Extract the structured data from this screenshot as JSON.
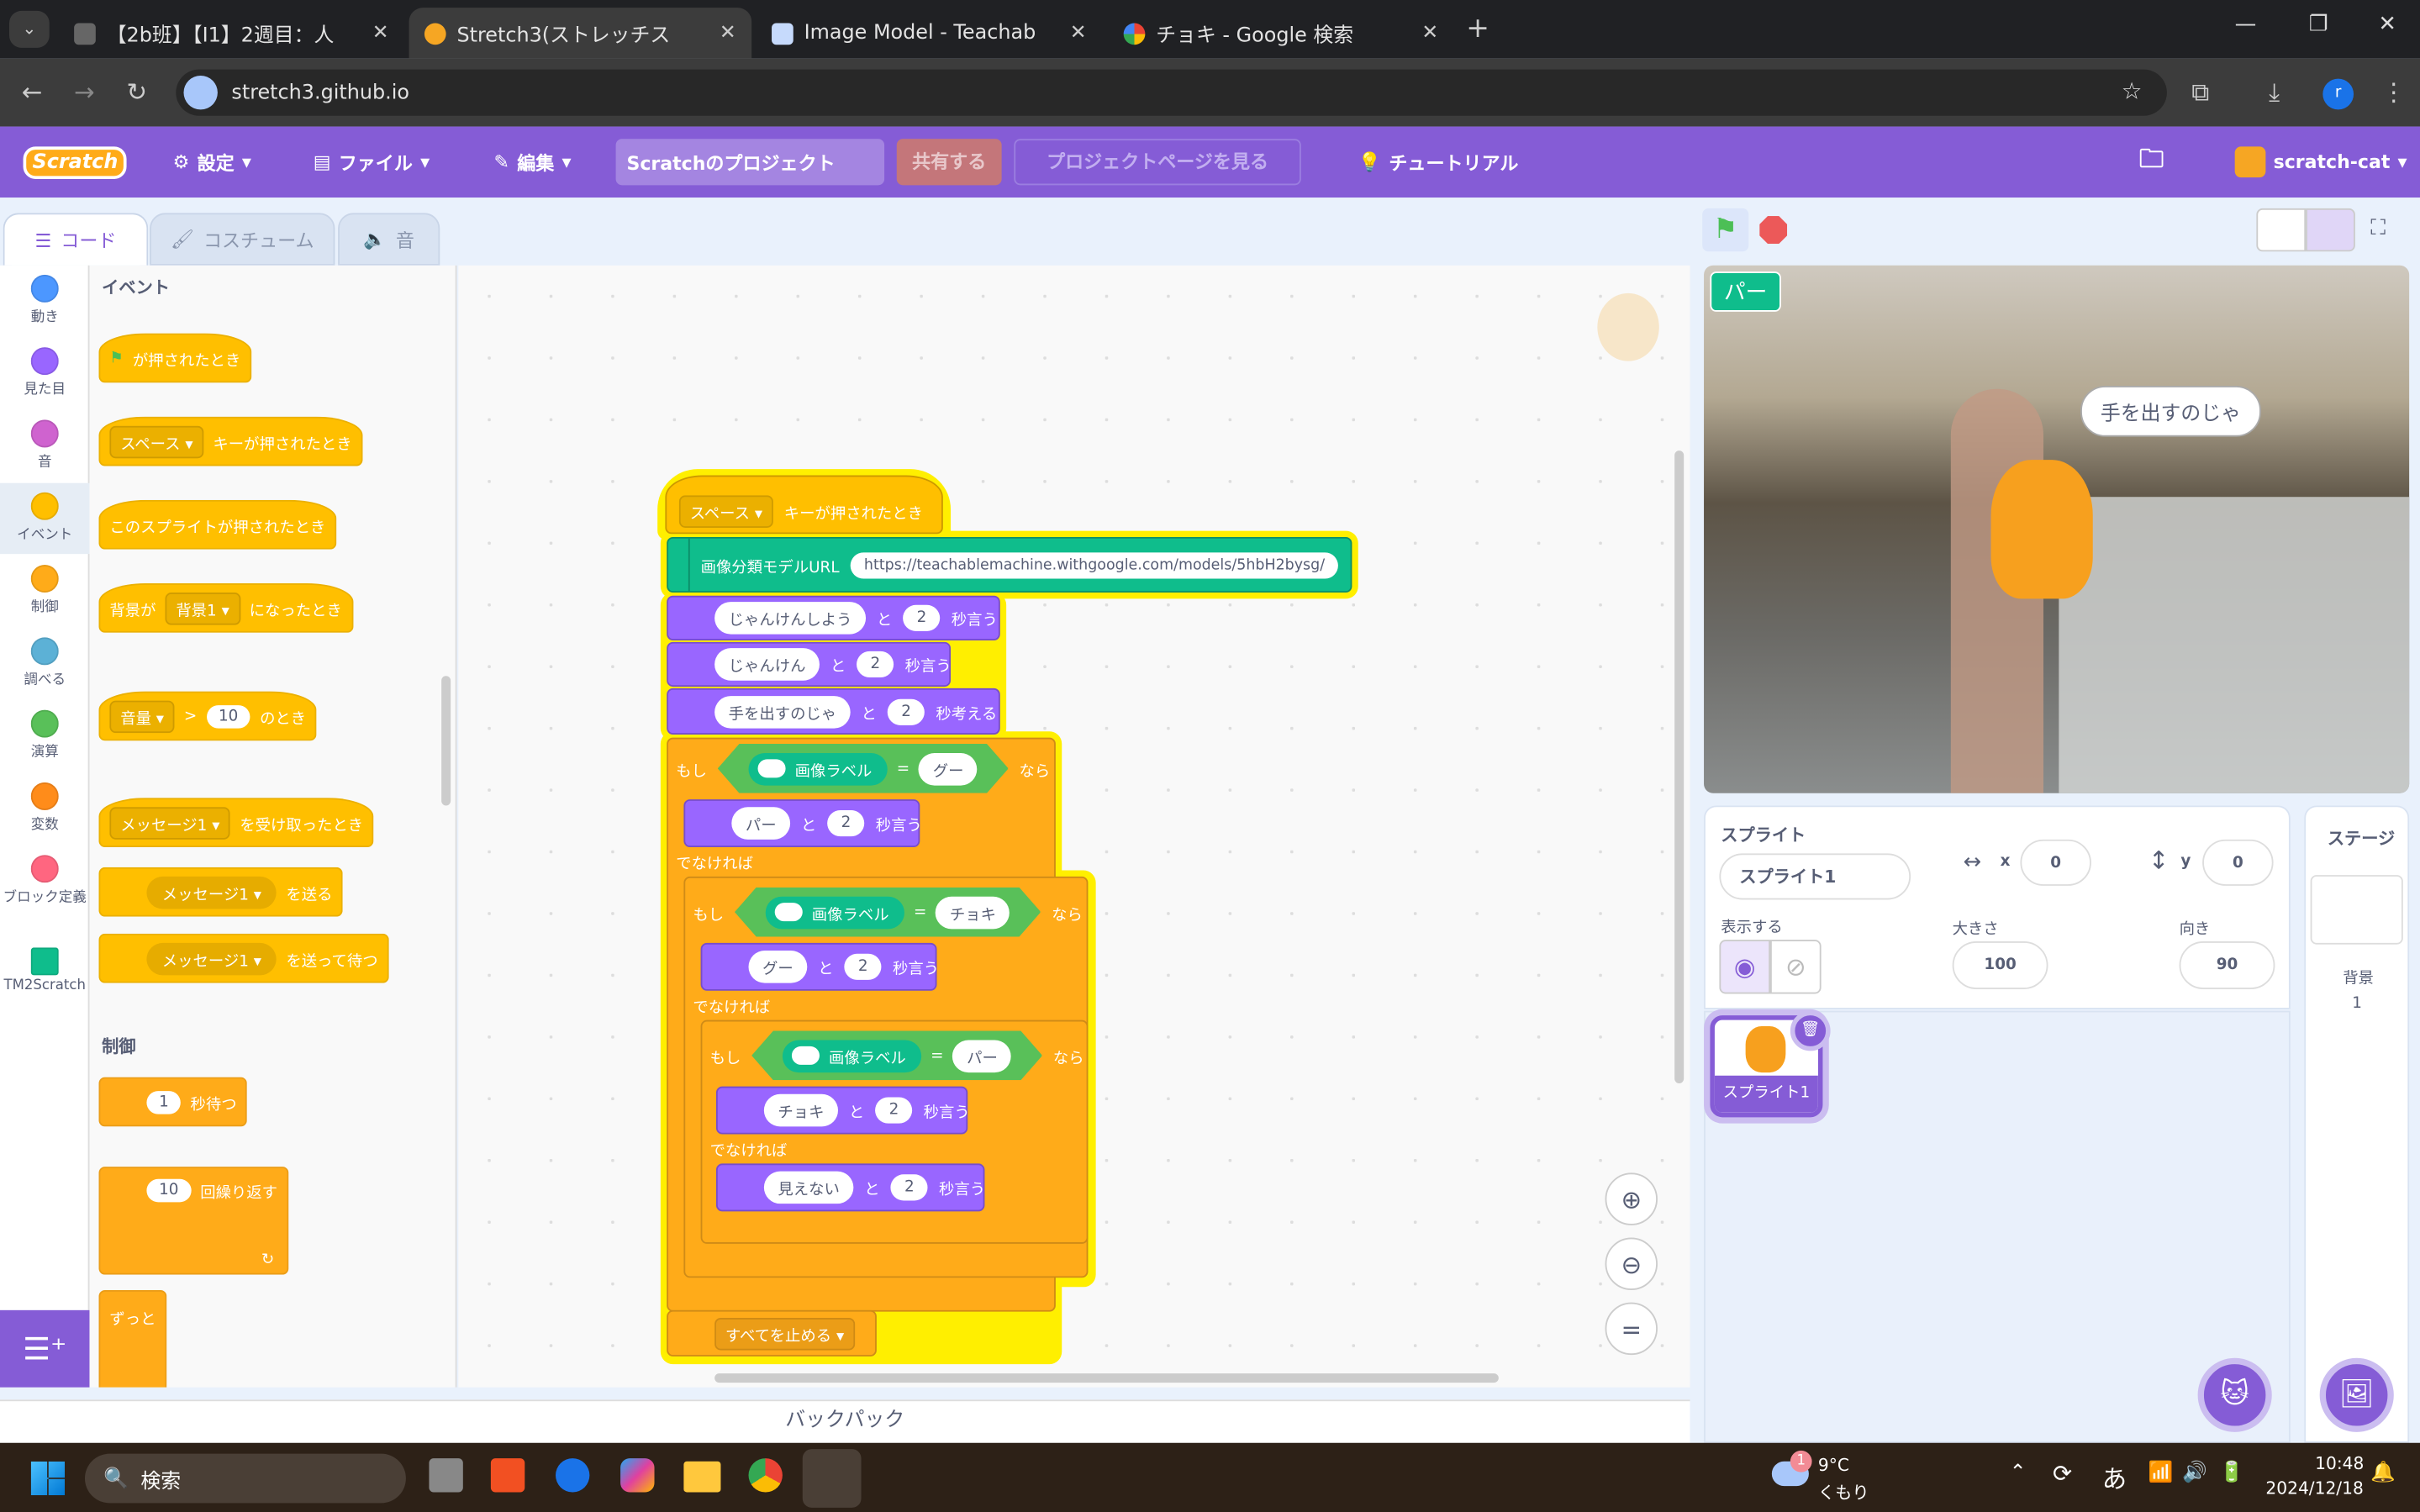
{
  "browser": {
    "tabs": [
      {
        "title": "【2b班】【I1】2週目：人",
        "active": false
      },
      {
        "title": "Stretch3(ストレッチス",
        "active": true
      },
      {
        "title": "Image Model - Teachab",
        "active": false
      },
      {
        "title": "チョキ - Google 検索",
        "active": false
      }
    ],
    "url": "stretch3.github.io"
  },
  "menu": {
    "logo": "Scratch",
    "settings": "設定",
    "file": "ファイル",
    "edit": "編集",
    "project_title": "Scratchのプロジェクト",
    "share": "共有する",
    "see_project_page": "プロジェクトページを見る",
    "tutorials": "チュートリアル",
    "user": "scratch-cat"
  },
  "editor_tabs": {
    "code": "コード",
    "costumes": "コスチューム",
    "sounds": "音"
  },
  "categories": [
    {
      "label": "動き",
      "color": "#4c97ff"
    },
    {
      "label": "見た目",
      "color": "#9966ff"
    },
    {
      "label": "音",
      "color": "#cf63cf"
    },
    {
      "label": "イベント",
      "color": "#ffbf00"
    },
    {
      "label": "制御",
      "color": "#ffab19"
    },
    {
      "label": "調べる",
      "color": "#5cb1d6"
    },
    {
      "label": "演算",
      "color": "#59c059"
    },
    {
      "label": "変数",
      "color": "#ff8c1a"
    },
    {
      "label": "ブロック定義",
      "color": "#ff6680"
    },
    {
      "label": "TM2Scratch",
      "color": "#0fbd8c"
    }
  ],
  "palette": {
    "events_heading": "イベント",
    "flag_clicked": "が押されたとき",
    "key_dd": "スペース",
    "key_pressed": "キーが押されたとき",
    "sprite_clicked": "このスプライトが押されたとき",
    "backdrop_prefix": "背景が",
    "backdrop_dd": "背景1",
    "backdrop_suffix": "になったとき",
    "loud_dd": "音量",
    "gt": ">",
    "loud_val": "10",
    "loud_suffix": "のとき",
    "msg_dd": "メッセージ1",
    "msg_received": "を受け取ったとき",
    "broadcast": "を送る",
    "broadcast_wait": "を送って待つ",
    "control_heading": "制御",
    "wait_val": "1",
    "wait": "秒待つ",
    "repeat_val": "10",
    "repeat": "回繰り返す",
    "forever": "ずっと"
  },
  "script": {
    "hat_dd": "スペース",
    "hat_label": "キーが押されたとき",
    "tm_label": "画像分類モデルURL",
    "tm_url": "https://teachablemachine.withgoogle.com/models/5hbH2bysg/",
    "say1": "じゃんけんしよう",
    "say2": "じゃんけん",
    "think": "手を出すのじゃ",
    "to": "と",
    "secs": "2",
    "say_suffix": "秒言う",
    "think_suffix": "秒考える",
    "if": "もし",
    "then": "なら",
    "else": "でなければ",
    "eq": "=",
    "image_label": "画像ラベル",
    "cond1": "グー",
    "resp1": "パー",
    "cond2": "チョキ",
    "resp2": "グー",
    "cond3": "パー",
    "resp3": "チョキ",
    "resp_else": "見えない",
    "stop_dd": "すべてを止める"
  },
  "backpack": "バックパック",
  "stage": {
    "label_monitor": "パー",
    "speech": "手を出すのじゃ"
  },
  "sprite_info": {
    "heading": "スプライト",
    "name": "スプライト1",
    "x_label": "x",
    "x": "0",
    "y_label": "y",
    "y": "0",
    "show_label": "表示する",
    "size_label": "大きさ",
    "size": "100",
    "direction_label": "向き",
    "direction": "90"
  },
  "sprite_list": [
    {
      "name": "スプライト1"
    }
  ],
  "stage_panel": {
    "heading": "ステージ",
    "backdrops_label": "背景",
    "backdrops_count": "1"
  },
  "taskbar": {
    "search": "検索",
    "weather_temp": "9°C",
    "weather_desc": "くもり",
    "weather_badge": "1",
    "ime": "あ",
    "time": "10:48",
    "date": "2024/12/18"
  }
}
